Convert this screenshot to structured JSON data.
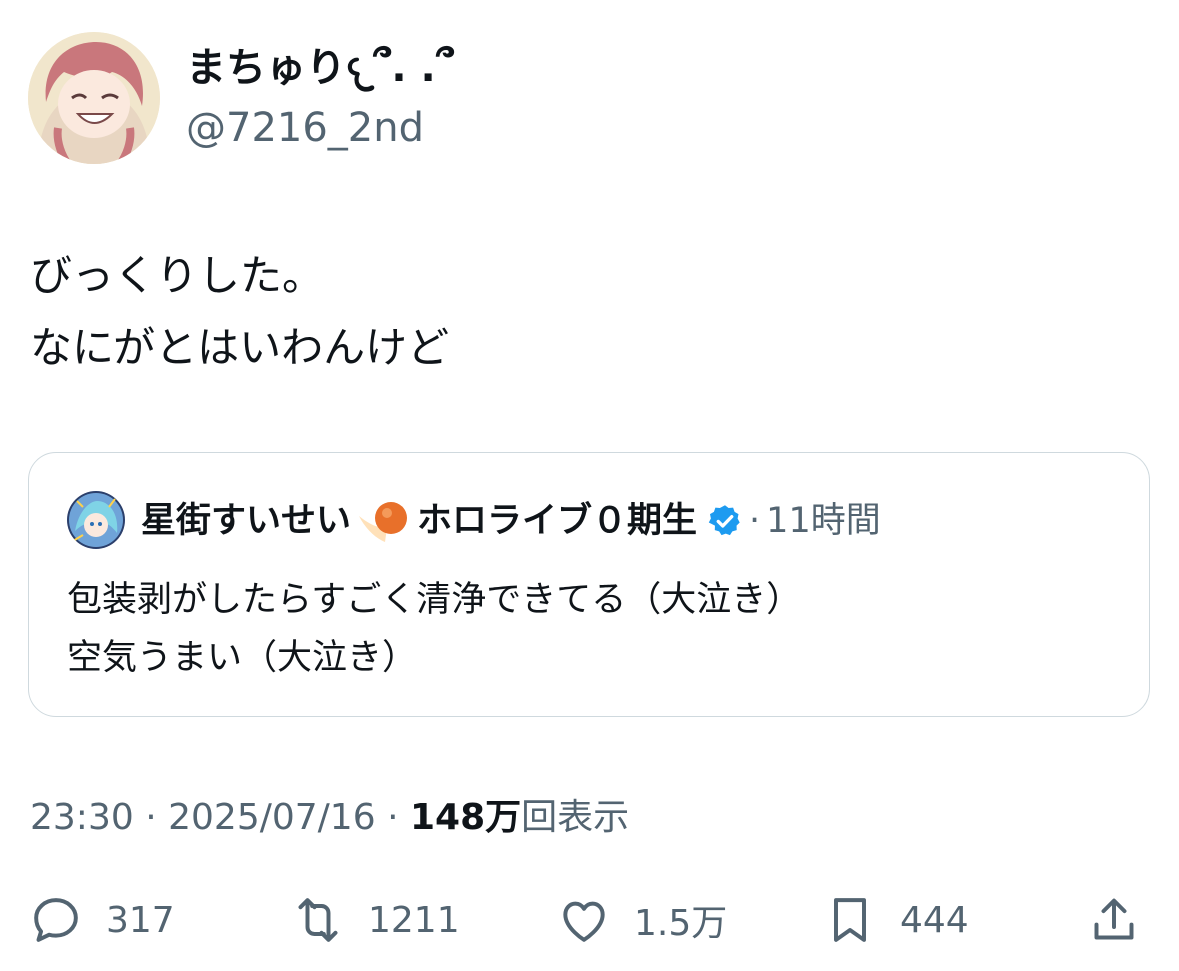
{
  "author": {
    "display_name": "まちゅり𐔌՞. .՞",
    "handle": "@7216_2nd"
  },
  "tweet": {
    "lines": [
      "びっくりした。",
      "なにがとはいわんけど"
    ]
  },
  "quoted": {
    "name": "星街すいせい",
    "name_suffix": "ホロライブ０期生",
    "time": "11時間",
    "separator": "·",
    "lines": [
      "包装剥がしたらすごく清浄できてる（大泣き）",
      "空気うまい（大泣き）"
    ]
  },
  "meta": {
    "time": "23:30",
    "date": "2025/07/16",
    "views_count": "148万",
    "views_label": "回表示",
    "separator": "·"
  },
  "actions": {
    "replies": "317",
    "retweets": "1211",
    "likes": "1.5万",
    "bookmarks": "444"
  },
  "icons": {
    "reply": "reply-icon",
    "retweet": "retweet-icon",
    "like": "heart-icon",
    "bookmark": "bookmark-icon",
    "share": "share-icon",
    "verified": "verified-badge-icon"
  },
  "colors": {
    "text": "#0f1419",
    "secondary": "#536471",
    "border": "#cfd9de",
    "verified": "#1d9bf0"
  }
}
